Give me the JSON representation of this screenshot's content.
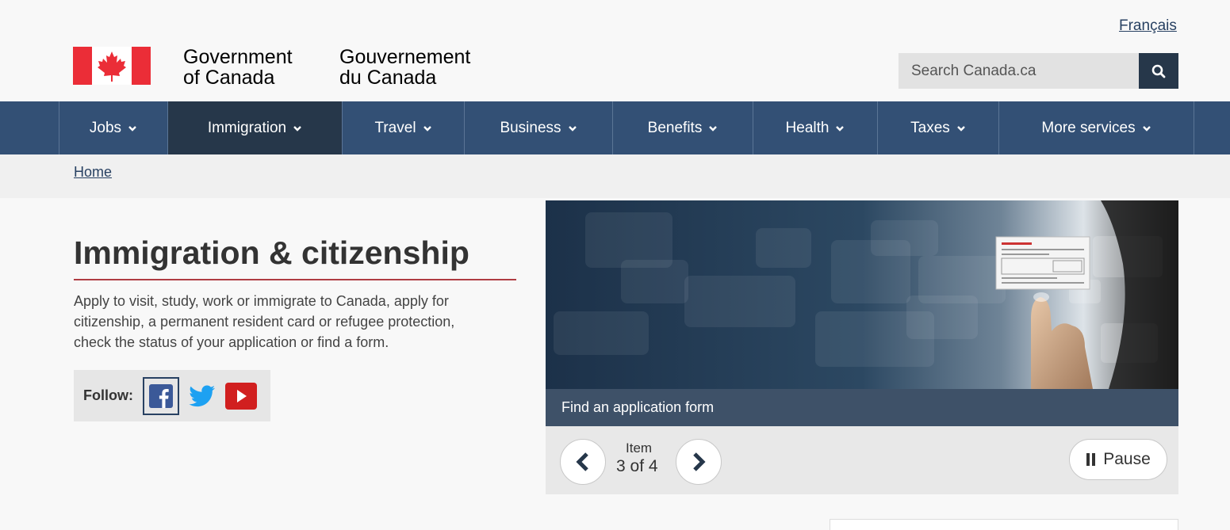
{
  "header": {
    "language_link": "Français",
    "gov_en_line1": "Government",
    "gov_en_line2": "of Canada",
    "gov_fr_line1": "Gouvernement",
    "gov_fr_line2": "du Canada",
    "search_placeholder": "Search Canada.ca"
  },
  "menu": {
    "items": [
      {
        "label": "Jobs"
      },
      {
        "label": "Immigration"
      },
      {
        "label": "Travel"
      },
      {
        "label": "Business"
      },
      {
        "label": "Benefits"
      },
      {
        "label": "Health"
      },
      {
        "label": "Taxes"
      },
      {
        "label": "More services"
      }
    ],
    "active": "Immigration"
  },
  "breadcrumb": {
    "home": "Home"
  },
  "main": {
    "title": "Immigration & citizenship",
    "intro_line1": "Apply to visit, study, work or immigrate to Canada, apply for",
    "intro_line2": "citizenship, a permanent resident card or refugee protection,",
    "intro_line3": "check the status of your application or find a form.",
    "follow_label": "Follow:",
    "social": [
      "facebook-icon",
      "twitter-icon",
      "youtube-icon"
    ]
  },
  "carousel": {
    "caption": "Find an application form",
    "item_word": "Item",
    "item_count": "3 of 4",
    "pause_label": "Pause"
  },
  "colors": {
    "menu_bg": "#335075",
    "menu_active": "#26374a",
    "link": "#284162",
    "title_rule": "#af3c43",
    "flag_red": "#eb2d37"
  }
}
